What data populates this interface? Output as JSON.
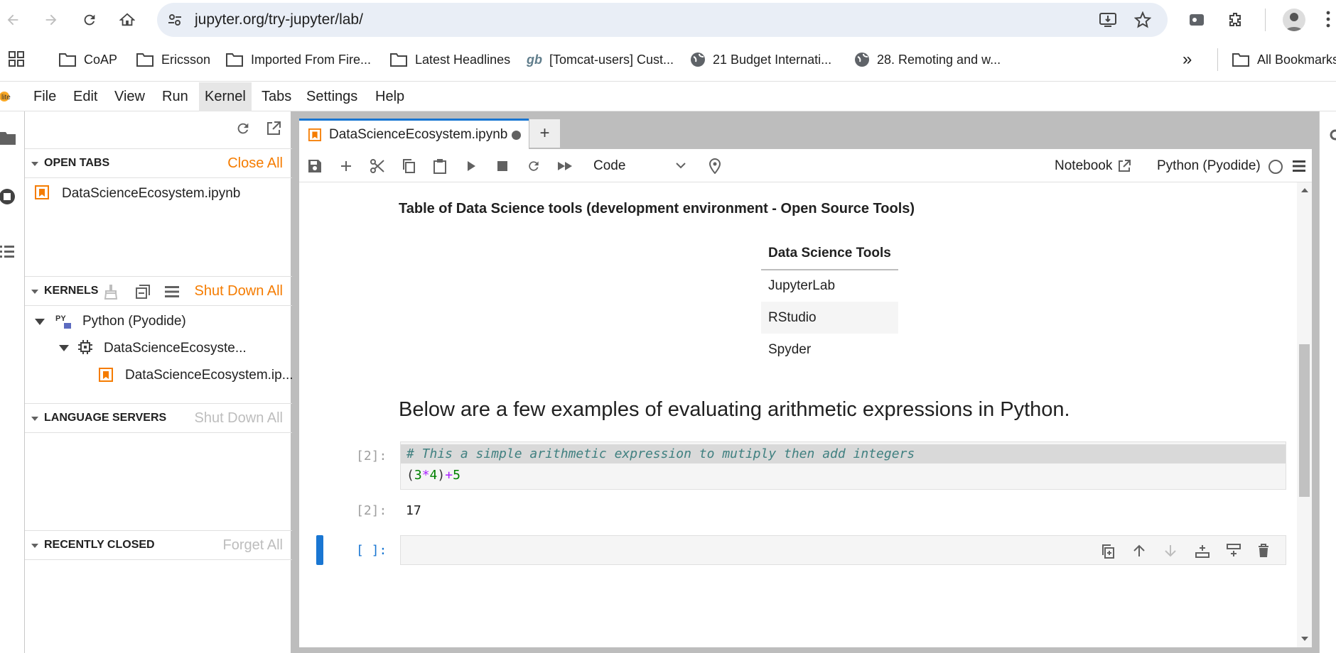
{
  "browser": {
    "url": "jupyter.org/try-jupyter/lab/",
    "bookmarks": [
      {
        "label": "CoAP",
        "icon": "folder-icon"
      },
      {
        "label": "Ericsson",
        "icon": "folder-icon"
      },
      {
        "label": "Imported From Fire...",
        "icon": "folder-icon"
      },
      {
        "label": "Latest Headlines",
        "icon": "folder-icon"
      },
      {
        "label": "[Tomcat-users] Cust...",
        "icon": "gb-icon"
      },
      {
        "label": "21 Budget Internati...",
        "icon": "globe-icon"
      },
      {
        "label": "28. Remoting and w...",
        "icon": "globe-icon"
      }
    ],
    "more_label": "»",
    "all_bookmarks": "All Bookmarks"
  },
  "menu": [
    "File",
    "Edit",
    "View",
    "Run",
    "Kernel",
    "Tabs",
    "Settings",
    "Help"
  ],
  "active_menu": "Kernel",
  "sidebar": {
    "open_tabs": {
      "title": "OPEN TABS",
      "action": "Close All",
      "items": [
        "DataScienceEcosystem.ipynb"
      ]
    },
    "kernels": {
      "title": "KERNELS",
      "action": "Shut Down All",
      "kernel": "Python (Pyodide)",
      "session": "DataScienceEcosyste...",
      "notebook": "DataScienceEcosystem.ip..."
    },
    "language_servers": {
      "title": "LANGUAGE SERVERS",
      "action": "Shut Down All"
    },
    "recently_closed": {
      "title": "RECENTLY CLOSED",
      "action": "Forget All"
    }
  },
  "notebook": {
    "tab_label": "DataScienceEcosystem.ipynb",
    "new_tab": "+",
    "cell_type": "Code",
    "notebook_link": "Notebook",
    "kernel_name": "Python (Pyodide)",
    "table_caption": "Table of Data Science tools (development environment - Open Source Tools)",
    "table_header": "Data Science Tools",
    "table_rows": [
      "JupyterLab",
      "RStudio",
      "Spyder"
    ],
    "heading": "Below are a few examples of evaluating arithmetic expressions in Python.",
    "code_prompt": "[2]:",
    "code_comment": "# This a simple arithmetic expression to mutiply then add integers",
    "code_tokens": [
      "(",
      "3",
      "*",
      "4",
      ")",
      "+",
      "5"
    ],
    "output_prompt": "[2]:",
    "output": "17",
    "empty_prompt": "[ ]:"
  },
  "colors": {
    "accent": "#1976d2",
    "orange": "#f57c00"
  }
}
